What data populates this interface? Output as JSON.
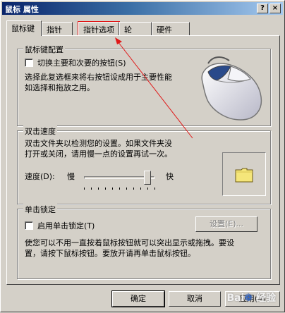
{
  "window": {
    "title": "鼠标 属性",
    "help_button": "?",
    "close_button": "×"
  },
  "tabs": [
    {
      "label": "鼠标键",
      "active": true
    },
    {
      "label": "指针",
      "active": false
    },
    {
      "label": "指针选项",
      "active": false,
      "highlighted": true
    },
    {
      "label": "轮",
      "active": false
    },
    {
      "label": "硬件",
      "active": false
    }
  ],
  "button_config": {
    "group_label": "鼠标键配置",
    "checkbox_label": "切换主要和次要的按钮(S)",
    "checked": false,
    "description_line1": "选择此复选框来将右按钮设成用于主要性能",
    "description_line2": "如选择和拖放之用。"
  },
  "double_click": {
    "group_label": "双击速度",
    "description_line1": "双击文件夹以检测您的设置。如果文件夹没",
    "description_line2": "打开或关闭，请用慢一点的设置再试一次。",
    "speed_label": "速度(D):",
    "slow_label": "慢",
    "fast_label": "快",
    "speed_value_fraction": 0.9,
    "test_icon": "folder-icon"
  },
  "click_lock": {
    "group_label": "单击锁定",
    "checkbox_label": "启用单击锁定(T)",
    "checked": false,
    "settings_button": "设置(E)...",
    "description_line1": "使您可以不用一直按着鼠标按钮就可以突出显示或拖拽。要设",
    "description_line2": "置，请按下鼠标按钮。要放开请再单击鼠标按钮。"
  },
  "footer": {
    "ok": "确定",
    "cancel": "取消",
    "apply": "应用(A)"
  },
  "watermark": "Bai 经验",
  "colors": {
    "face": "#d4d0c8",
    "title_start": "#0a246a",
    "title_end": "#a6caf0",
    "annotation_red": "#e01818",
    "folder_yellow": "#f5e67a",
    "mouse_blue": "#2a4a8a"
  }
}
